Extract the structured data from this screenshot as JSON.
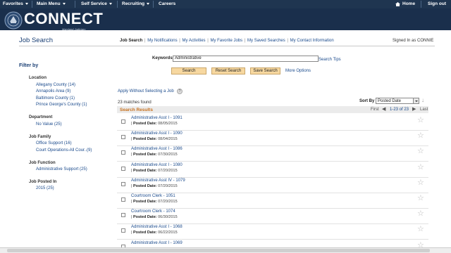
{
  "topnav": {
    "favorites": "Favorites",
    "main_menu": "Main Menu",
    "self_service": "Self Service",
    "recruiting": "Recruiting",
    "careers": "Careers",
    "home": "Home",
    "sign_out": "Sign out"
  },
  "header": {
    "logo_text": "CONNECT",
    "logo_sub": "Maryland Judiciary"
  },
  "page": {
    "title": "Job Search",
    "signed_in": "Signed In as CONNIE"
  },
  "subnav": [
    {
      "label": "Job Search",
      "active": true
    },
    {
      "label": "My Notifications"
    },
    {
      "label": "My Activities"
    },
    {
      "label": "My Favorite Jobs"
    },
    {
      "label": "My Saved Searches"
    },
    {
      "label": "My Contact Information"
    }
  ],
  "filter": {
    "heading": "Filter by",
    "groups": [
      {
        "name": "Location",
        "items": [
          "Allegany County (14)",
          "Annapolis Area (9)",
          "Baltimore County (1)",
          "Prince George's County (1)"
        ]
      },
      {
        "name": "Department",
        "items": [
          "No Value (25)"
        ]
      },
      {
        "name": "Job Family",
        "items": [
          "Office Support (16)",
          "Court Operations-All Cour..(9)"
        ]
      },
      {
        "name": "Job Function",
        "items": [
          "Administrative Support (25)"
        ]
      },
      {
        "name": "Job Posted In",
        "items": [
          "2015 (25)"
        ]
      }
    ]
  },
  "search": {
    "keywords_label": "Keywords",
    "keywords_value": "Administrative",
    "search_tips": "Search Tips",
    "search_btn": "Search",
    "reset_btn": "Reset Search",
    "save_btn": "Save Search",
    "more_options": "More Options"
  },
  "results": {
    "apply_without": "Apply Without Selecting a Job",
    "matches": "23 matches found",
    "sort_label": "Sort By",
    "sort_value": "Posted Date",
    "heading": "Search Results",
    "pager_first": "First",
    "pager_range": "1-23 of 23",
    "pager_last": "Last",
    "posted_label": "Posted Date:",
    "rows": [
      {
        "title": "Administrative Asst I - 1091",
        "date": "08/05/2015"
      },
      {
        "title": "Administrative Asst I - 1090",
        "date": "08/04/2015"
      },
      {
        "title": "Administrative Asst I - 1086",
        "date": "07/30/2015"
      },
      {
        "title": "Administrative Asst I - 1080",
        "date": "07/20/2015"
      },
      {
        "title": "Administrative Asst IV - 1079",
        "date": "07/20/2015"
      },
      {
        "title": "Courtroom Clerk - 1051",
        "date": "07/20/2015"
      },
      {
        "title": "Courtroom Clerk - 1074",
        "date": "06/30/2015"
      },
      {
        "title": "Administrative Asst I - 1068",
        "date": "06/22/2015"
      },
      {
        "title": "Administrative Asst I - 1069",
        "date": ""
      }
    ]
  }
}
